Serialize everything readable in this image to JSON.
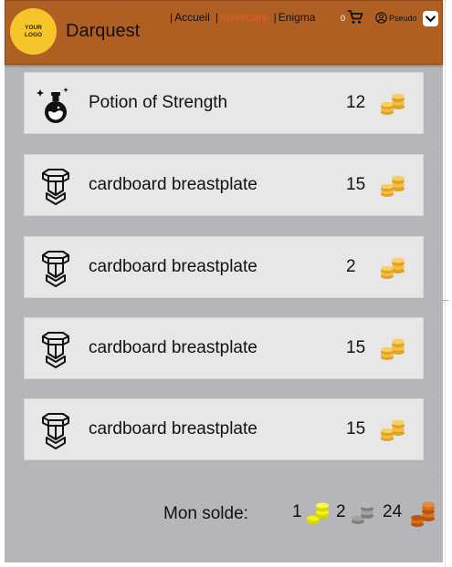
{
  "header": {
    "logo_text": "YOUR LOGO",
    "brand": "Darquest",
    "nav": [
      {
        "label": "Accueil",
        "active": false
      },
      {
        "label": "Inventaire",
        "active": true
      },
      {
        "label": "Enigma",
        "active": false
      }
    ],
    "separator": "|",
    "cart_count": "0",
    "user_label": "Pseudo",
    "icons": {
      "cart": "cart-icon",
      "user": "user-circle-icon",
      "dropdown": "chevron-down-icon"
    }
  },
  "items": [
    {
      "name": "Potion of Strength",
      "price": "12",
      "icon": "potion-icon"
    },
    {
      "name": "cardboard breastplate",
      "price": "15",
      "icon": "breastplate-icon"
    },
    {
      "name": "cardboard breastplate",
      "price": "2",
      "icon": "breastplate-icon"
    },
    {
      "name": "cardboard breastplate",
      "price": "15",
      "icon": "breastplate-icon"
    },
    {
      "name": "cardboard breastplate",
      "price": "15",
      "icon": "breastplate-icon"
    }
  ],
  "balance": {
    "label": "Mon solde:",
    "gold": "1",
    "silver": "2",
    "copper": "24"
  },
  "colors": {
    "header": "#b05f22",
    "background": "#b5b6b9",
    "card": "#e7e7e7",
    "active_nav": "#e85a2a",
    "logo": "#f6c52a"
  }
}
